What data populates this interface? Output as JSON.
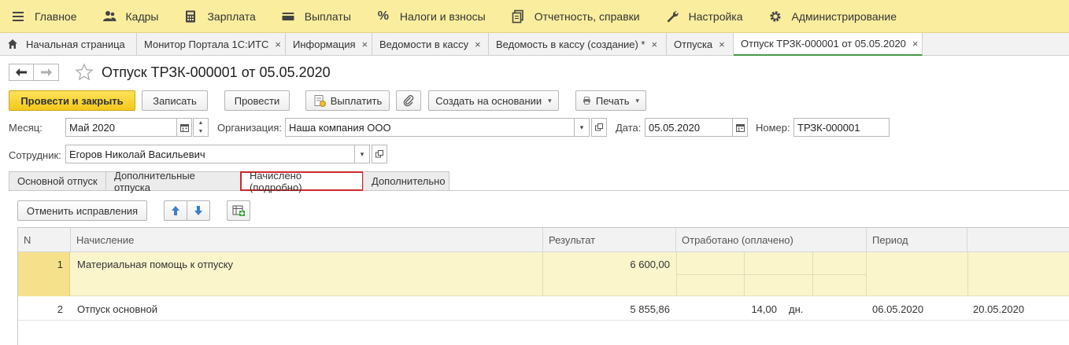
{
  "menu": [
    {
      "label": "Главное",
      "icon": "hamburger-icon"
    },
    {
      "label": "Кадры",
      "icon": "people-icon"
    },
    {
      "label": "Зарплата",
      "icon": "calculator-icon"
    },
    {
      "label": "Выплаты",
      "icon": "wallet-icon"
    },
    {
      "label": "Налоги и взносы",
      "icon": "percent-icon"
    },
    {
      "label": "Отчетность, справки",
      "icon": "documents-icon"
    },
    {
      "label": "Настройка",
      "icon": "wrench-icon"
    },
    {
      "label": "Администрирование",
      "icon": "gear-icon"
    }
  ],
  "tabs": [
    {
      "label": "Начальная страница",
      "close": ""
    },
    {
      "label": "Монитор Портала 1С:ИТС",
      "close": "×"
    },
    {
      "label": "Информация",
      "close": "×"
    },
    {
      "label": "Ведомости в кассу",
      "close": "×"
    },
    {
      "label": "Ведомость в кассу (создание) *",
      "close": "×"
    },
    {
      "label": "Отпуска",
      "close": "×"
    },
    {
      "label": "Отпуск ТРЗК-000001 от 05.05.2020",
      "close": "×"
    }
  ],
  "header": {
    "back": "🡐",
    "forward": "🡒",
    "title": "Отпуск ТРЗК-000001 от 05.05.2020"
  },
  "toolbar": {
    "post_close": "Провести и закрыть",
    "save": "Записать",
    "post": "Провести",
    "pay": "Выплатить",
    "create_based": "Создать на основании",
    "print": "Печать",
    "caret": "▾"
  },
  "form": {
    "month_label": "Месяц:",
    "month_value": "Май 2020",
    "org_label": "Организация:",
    "org_value": "Наша компания ООО",
    "date_label": "Дата:",
    "date_value": "05.05.2020",
    "number_label": "Номер:",
    "number_value": "ТРЗК-000001",
    "employee_label": "Сотрудник:",
    "employee_value": "Егоров Николай Васильевич"
  },
  "form_tabs": [
    {
      "label": "Основной отпуск"
    },
    {
      "label": "Дополнительные отпуска"
    },
    {
      "label": "Начислено (подробно)"
    },
    {
      "label": "Дополнительно"
    }
  ],
  "subtoolbar": {
    "cancel_corrections": "Отменить исправления"
  },
  "table": {
    "columns": [
      "N",
      "Начисление",
      "Результат",
      "Отработано (оплачено)",
      "Период"
    ],
    "rows": [
      {
        "n": "1",
        "accrual": "Материальная помощь к отпуску",
        "result": "6 600,00",
        "worked": "",
        "unit": "",
        "period_from": "",
        "period_to": ""
      },
      {
        "n": "2",
        "accrual": "Отпуск основной",
        "result": "5 855,86",
        "worked": "14,00",
        "unit": "дн.",
        "period_from": "06.05.2020",
        "period_to": "20.05.2020"
      }
    ]
  }
}
